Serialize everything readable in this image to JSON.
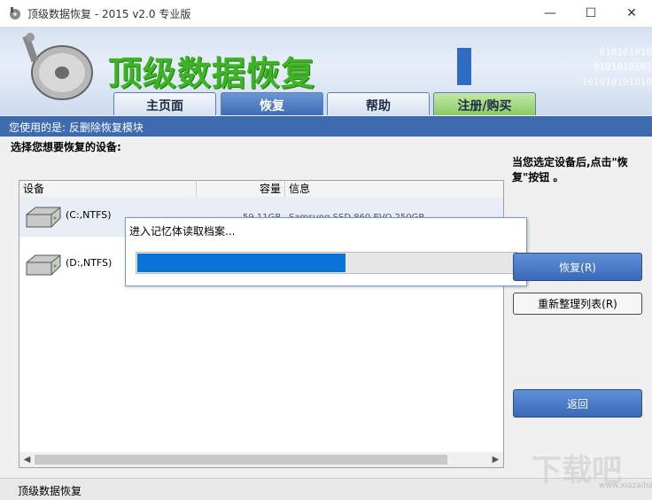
{
  "window": {
    "title": "顶级数据恢复 - 2015 v2.0 专业版",
    "minimize": "—",
    "maximize": "☐",
    "close": "✕"
  },
  "banner": {
    "title": "顶级数据恢复",
    "binary_lines": [
      "010101010",
      "0101010101",
      "101010101010"
    ]
  },
  "tabs": [
    {
      "label": "主页面"
    },
    {
      "label": "恢复"
    },
    {
      "label": "帮助"
    },
    {
      "label": "注册/购买"
    }
  ],
  "status_strip": "您使用的是: 反删除恢复模块",
  "select_label": "选择您想要恢复的设备:",
  "hint": "当您选定设备后,点击\"恢复\"按钮 。",
  "device_list": {
    "columns": [
      "设备",
      "容量",
      "信息"
    ],
    "rows": [
      {
        "label": "(C:,NTFS)",
        "capacity": "59.11GB",
        "info": "Samsung SSD 860 EVO 250GB"
      },
      {
        "label": "(D:,NTFS)",
        "capacity": "",
        "info": ""
      }
    ]
  },
  "progress": {
    "label": "进入记忆体读取档案...",
    "fraction": 0.55
  },
  "buttons": {
    "recover": "恢复(R)",
    "refresh": "重新整理列表(R)",
    "back": "返回"
  },
  "statusbar": "顶级数据恢复",
  "watermark": {
    "text": "下载吧",
    "url": "www.xiazaiba.com"
  },
  "colors": {
    "accent": "#3e6ab0",
    "banner_title": "#3cb423",
    "progress": "#0a74d6"
  }
}
